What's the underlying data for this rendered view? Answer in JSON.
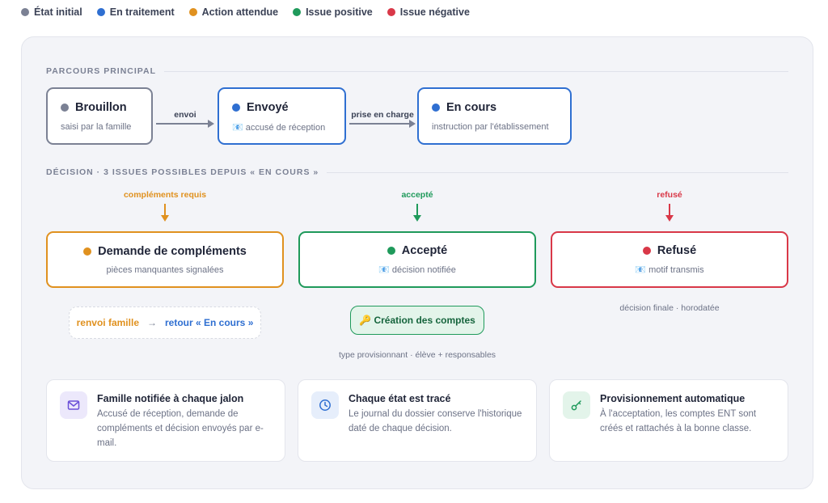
{
  "legend": [
    {
      "label": "État initial",
      "color": "#7b8194"
    },
    {
      "label": "En traitement",
      "color": "#2f6fd1"
    },
    {
      "label": "Action attendue",
      "color": "#e0911f"
    },
    {
      "label": "Issue positive",
      "color": "#1f9a5b"
    },
    {
      "label": "Issue négative",
      "color": "#d93848"
    }
  ],
  "main_path": {
    "title": "PARCOURS PRINCIPAL",
    "nodes": [
      {
        "title": "Brouillon",
        "sub": "saisi par la famille",
        "color": "#7b8194"
      },
      {
        "title": "Envoyé",
        "sub": "📧 accusé de réception",
        "color": "#2f6fd1"
      },
      {
        "title": "En cours",
        "sub": "instruction par l'établissement",
        "color": "#2f6fd1"
      }
    ],
    "edges": [
      "envoi",
      "prise en charge"
    ]
  },
  "decision": {
    "title": "DÉCISION · 3 ISSUES POSSIBLES DEPUIS « EN COURS »",
    "outcomes": [
      {
        "trigger": "compléments requis",
        "title": "Demande de compléments",
        "sub": "pièces manquantes signalées",
        "color": "#e0911f"
      },
      {
        "trigger": "accepté",
        "title": "Accepté",
        "sub": "📧 décision notifiée",
        "color": "#1f9a5b"
      },
      {
        "trigger": "refusé",
        "title": "Refusé",
        "sub": "📧 motif transmis",
        "color": "#d93848"
      }
    ],
    "loop": {
      "from": "renvoi famille",
      "arrow": "→",
      "to": "retour « En cours »"
    },
    "accounts": {
      "label": "🔑 Création des comptes",
      "note": "type provisionnant · élève + responsables"
    },
    "final_note": "décision finale · horodatée"
  },
  "cards": [
    {
      "icon": "mail-icon",
      "title": "Famille notifiée à chaque jalon",
      "desc": "Accusé de réception, demande de compléments et décision envoyés par e-mail.",
      "bg": "#ece8fb",
      "fg": "#6b4fd8"
    },
    {
      "icon": "clock-icon",
      "title": "Chaque état est tracé",
      "desc": "Le journal du dossier conserve l'historique daté de chaque décision.",
      "bg": "#e6eefb",
      "fg": "#2f6fd1"
    },
    {
      "icon": "key-icon",
      "title": "Provisionnement automatique",
      "desc": "À l'acceptation, les comptes ENT sont créés et rattachés à la bonne classe.",
      "bg": "#e3f4ea",
      "fg": "#1f9a5b"
    }
  ]
}
